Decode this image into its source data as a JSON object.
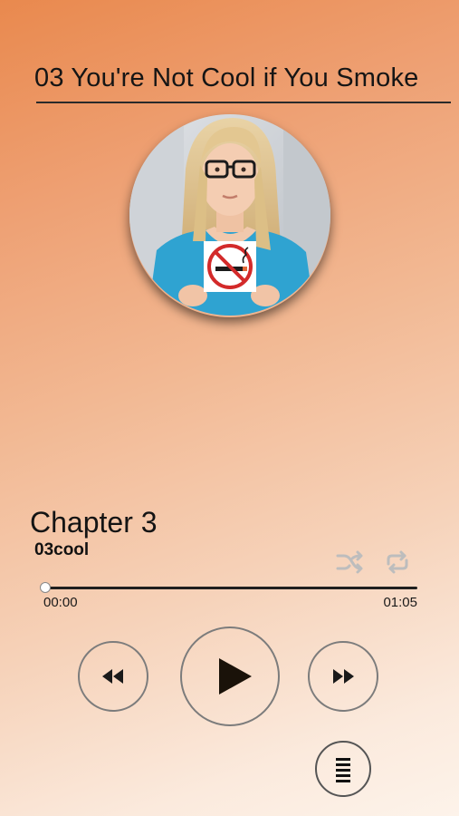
{
  "header": {
    "title": "03 You're Not Cool if You Smoke"
  },
  "cover": {
    "image": "woman-holding-no-smoking-sign"
  },
  "track": {
    "chapter": "Chapter 3",
    "id": "03cool"
  },
  "player": {
    "elapsed": "00:00",
    "duration": "01:05",
    "progress_fraction": 0.0,
    "shuffle_icon": "shuffle-icon",
    "repeat_icon": "repeat-icon",
    "rewind_icon": "rewind-icon",
    "play_icon": "play-icon",
    "forward_icon": "fast-forward-icon",
    "playlist_icon": "playlist-menu-icon"
  },
  "colors": {
    "accent_dark": "#1a1a1a",
    "control_ring": "#7c7c7c",
    "icon_muted": "#bfbfbf",
    "sign_red": "#d32a2a",
    "top_tile_orange": "#e9894e"
  }
}
